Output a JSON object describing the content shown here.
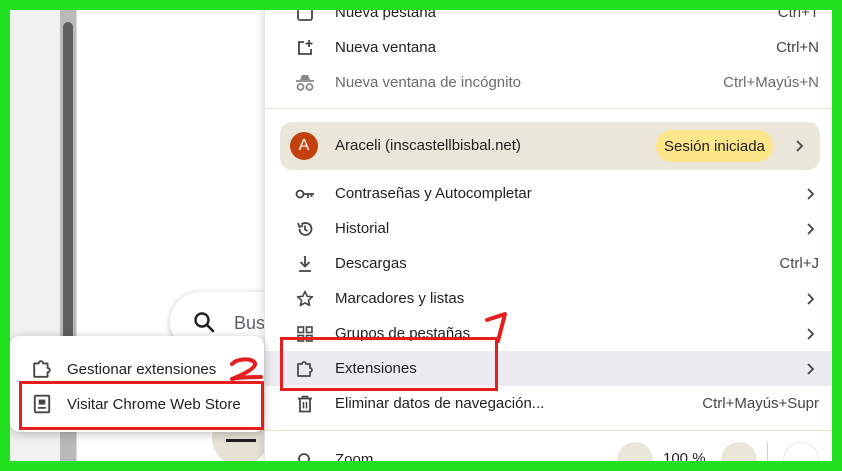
{
  "menu": {
    "items_top": [
      {
        "label": "Nueva pestaña",
        "shortcut": "Ctrl+T",
        "icon": "new-tab-icon"
      },
      {
        "label": "Nueva ventana",
        "shortcut": "Ctrl+N",
        "icon": "new-window-icon"
      },
      {
        "label": "Nueva ventana de incógnito",
        "shortcut": "Ctrl+Mayús+N",
        "icon": "incognito-icon"
      }
    ],
    "profile": {
      "initial": "A",
      "name": "Araceli (inscastellbisbal.net)",
      "status": "Sesión iniciada",
      "avatar_color": "#c2410c",
      "badge_color": "#fde68a"
    },
    "items_main": [
      {
        "label": "Contraseñas y Autocompletar",
        "shortcut": "",
        "icon": "key-icon",
        "submenu": true
      },
      {
        "label": "Historial",
        "shortcut": "",
        "icon": "history-icon",
        "submenu": true
      },
      {
        "label": "Descargas",
        "shortcut": "Ctrl+J",
        "icon": "download-icon",
        "submenu": false
      },
      {
        "label": "Marcadores y listas",
        "shortcut": "",
        "icon": "star-icon",
        "submenu": true
      },
      {
        "label": "Grupos de pestañas",
        "shortcut": "",
        "icon": "tab-groups-icon",
        "submenu": true
      },
      {
        "label": "Extensiones",
        "shortcut": "",
        "icon": "extension-icon",
        "submenu": true
      },
      {
        "label": "Eliminar datos de navegación...",
        "shortcut": "Ctrl+Mayús+Supr",
        "icon": "trash-icon",
        "submenu": false
      }
    ],
    "zoom": {
      "label": "Zoom",
      "value": "100 %"
    }
  },
  "submenu": {
    "items": [
      {
        "label": "Gestionar extensiones",
        "icon": "extension-icon"
      },
      {
        "label": "Visitar Chrome Web Store",
        "icon": "web-store-icon"
      }
    ]
  },
  "page": {
    "search_placeholder": "Bus"
  },
  "annotations": {
    "step1": "1",
    "step2": "2",
    "color": "#e51e1e",
    "frame_color": "#22e01f"
  }
}
